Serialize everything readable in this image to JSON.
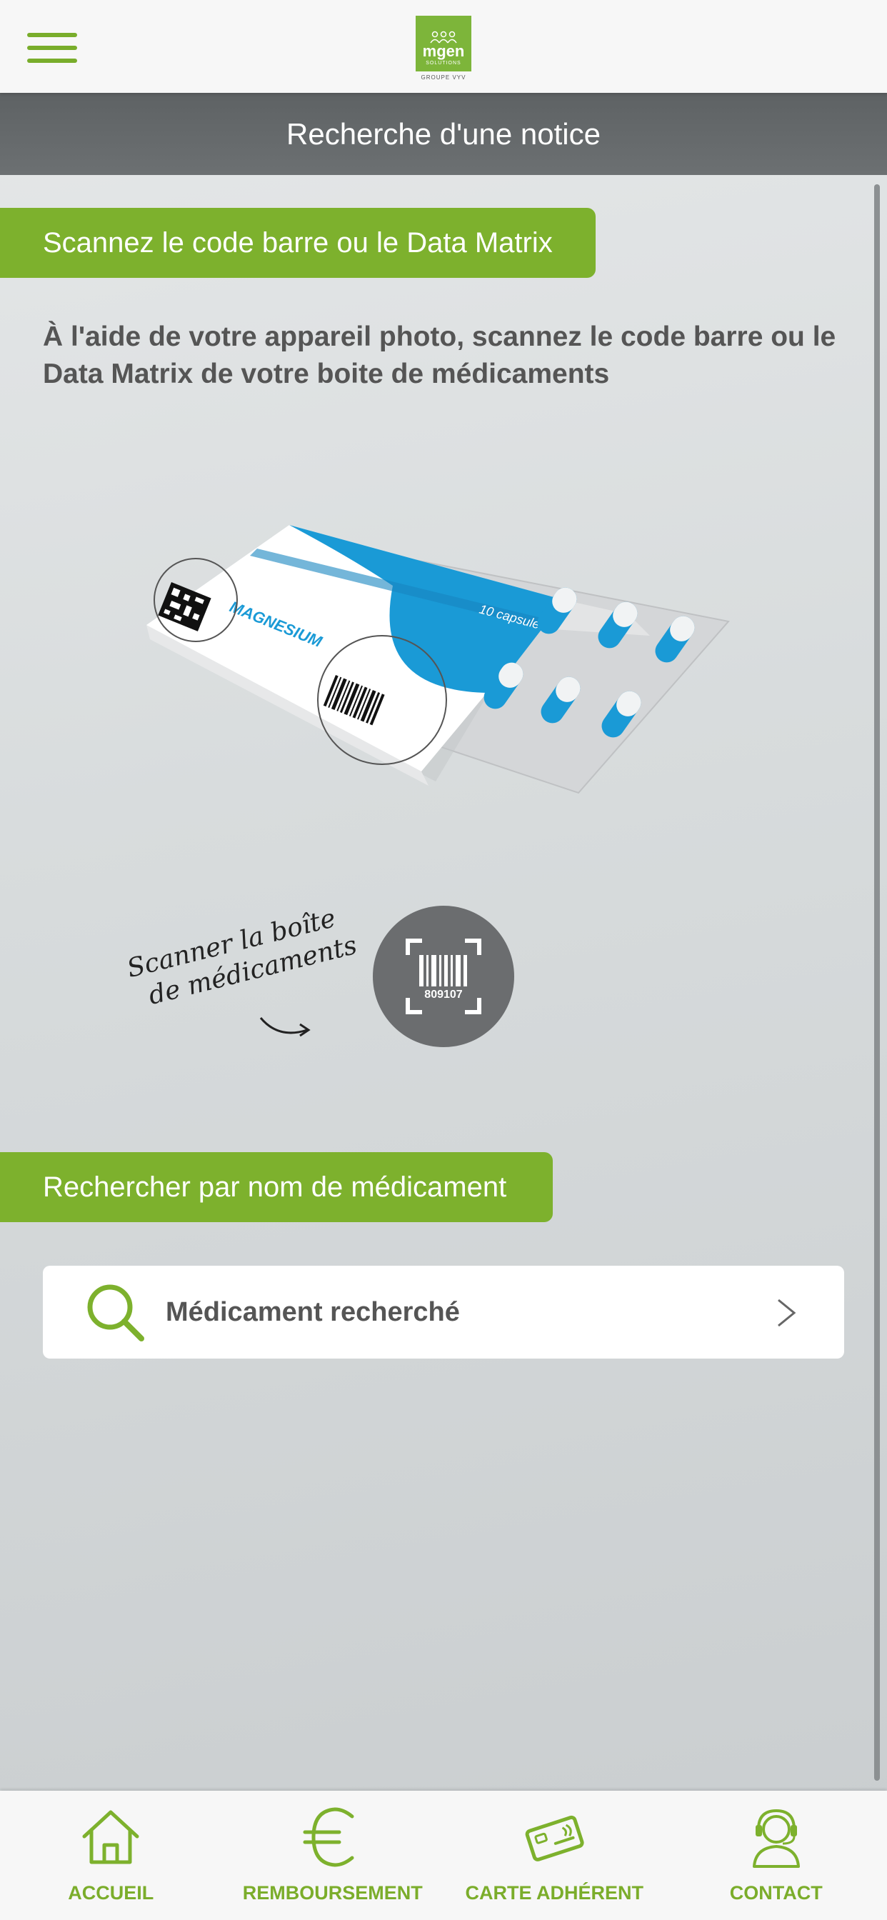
{
  "header": {
    "menu_icon": "hamburger-menu-icon",
    "logo": {
      "brand": "mgen",
      "sub": "SOLUTIONS",
      "group": "GROUPE VYV"
    },
    "title": "Recherche d'une notice"
  },
  "colors": {
    "accent_green": "#7db12d",
    "title_bar": "#64686a",
    "scan_button": "#6b6d6f"
  },
  "scan_section": {
    "heading": "Scannez le code barre ou le Data Matrix",
    "description": "À l'aide de votre appareil photo, scannez le code barre ou le Data Matrix de votre boite de médicaments",
    "illustration": {
      "box_label": "MAGNESIUM",
      "box_tag": "10 capsules"
    },
    "hint_line1": "Scanner la boîte",
    "hint_line2": "de médicaments",
    "scan_button_code": "809107",
    "scan_button_icon": "barcode-scan-icon"
  },
  "search_section": {
    "heading": "Rechercher par nom de médicament",
    "search_label": "Médicament recherché",
    "search_icon": "search-icon",
    "chevron_icon": "chevron-right-icon"
  },
  "bottom_nav": {
    "items": [
      {
        "label": "ACCUEIL",
        "icon": "home-icon"
      },
      {
        "label": "REMBOURSEMENT",
        "icon": "euro-icon"
      },
      {
        "label": "CARTE ADHÉRENT",
        "icon": "card-icon"
      },
      {
        "label": "CONTACT",
        "icon": "headset-icon"
      }
    ]
  }
}
